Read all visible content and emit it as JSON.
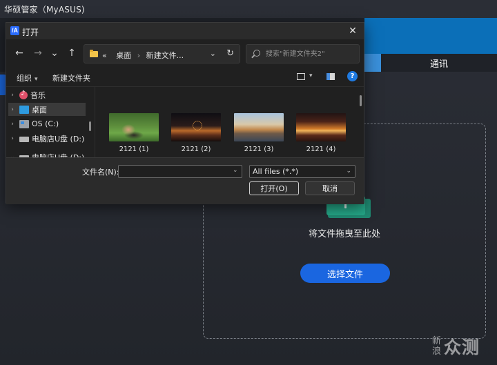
{
  "app": {
    "title": "华硕管家（MyASUS)",
    "tab_label": "通讯"
  },
  "drop_zone": {
    "prompt": "将文件拖曳至此处",
    "select_button": "选择文件"
  },
  "watermark": {
    "line1": "新",
    "line2": "浪",
    "brand": "众测"
  },
  "dialog": {
    "app_icon_text": "/A",
    "title": "打开",
    "close_glyph": "✕",
    "nav": {
      "back": "←",
      "forward": "→",
      "recent": "⌄",
      "up": "↑"
    },
    "address": {
      "prefix": "«",
      "crumb1": "桌面",
      "separator": "›",
      "crumb2": "新建文件...",
      "dropdown": "⌄",
      "refresh": "↻"
    },
    "search": {
      "placeholder": "搜索\"新建文件夹2\""
    },
    "toolbar": {
      "organize": "组织",
      "organize_caret": "▾",
      "new_folder": "新建文件夹",
      "view_caret": "▾",
      "help": "?"
    },
    "nav_pane": [
      {
        "label": "音乐",
        "expander": "›",
        "icon": "music-icon"
      },
      {
        "label": "桌面",
        "expander": "›",
        "icon": "desktop-icon",
        "selected": true
      },
      {
        "label": "OS (C:)",
        "expander": "›",
        "icon": "os-drive-icon"
      },
      {
        "label": "电脑店U盘 (D:)",
        "expander": "›",
        "icon": "usb-drive-icon"
      },
      {
        "label": "电脑店U盘 (D:)",
        "expander": "⌄",
        "icon": "usb-drive-icon"
      }
    ],
    "files": [
      {
        "name": "2121 (1)"
      },
      {
        "name": "2121 (2)"
      },
      {
        "name": "2121 (3)"
      },
      {
        "name": "2121 (4)"
      }
    ],
    "footer": {
      "filename_label": "文件名(N):",
      "filename_value": "",
      "filename_caret": "⌄",
      "filter_value": "All files (*.*)",
      "filter_caret": "⌄",
      "open_button": "打开(O)",
      "cancel_button": "取消"
    }
  }
}
